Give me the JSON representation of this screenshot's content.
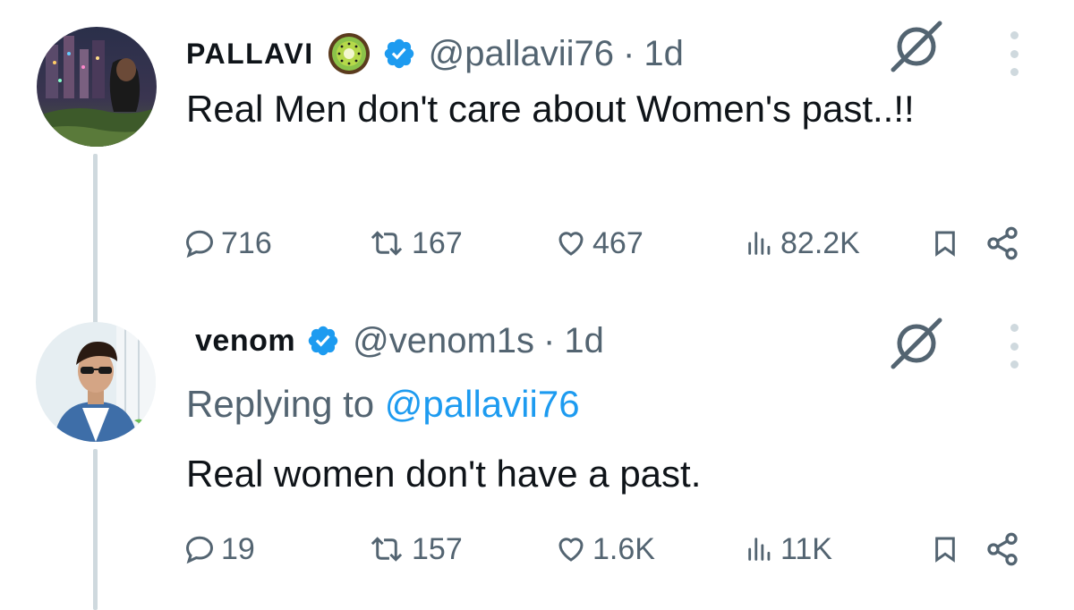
{
  "colors": {
    "accent": "#1d9bf0",
    "secondary_text": "#536471",
    "thread_line": "#cfd9de"
  },
  "tweets": [
    {
      "name": "PALLAVI",
      "emoji": "kiwi-emoji",
      "verified": true,
      "handle": "@pallavii76",
      "separator": "·",
      "time": "1d",
      "text": "Real Men don't care about Women's past..!!",
      "replies": "716",
      "retweets": "167",
      "likes": "467",
      "views": "82.2K"
    },
    {
      "name": "venom",
      "verified": true,
      "handle": "@venom1s",
      "separator": "·",
      "time": "1d",
      "replying_prefix": "Replying to",
      "replying_to": "@pallavii76",
      "text": "Real women don't have a past.",
      "replies": "19",
      "retweets": "157",
      "likes": "1.6K",
      "views": "11K"
    }
  ]
}
